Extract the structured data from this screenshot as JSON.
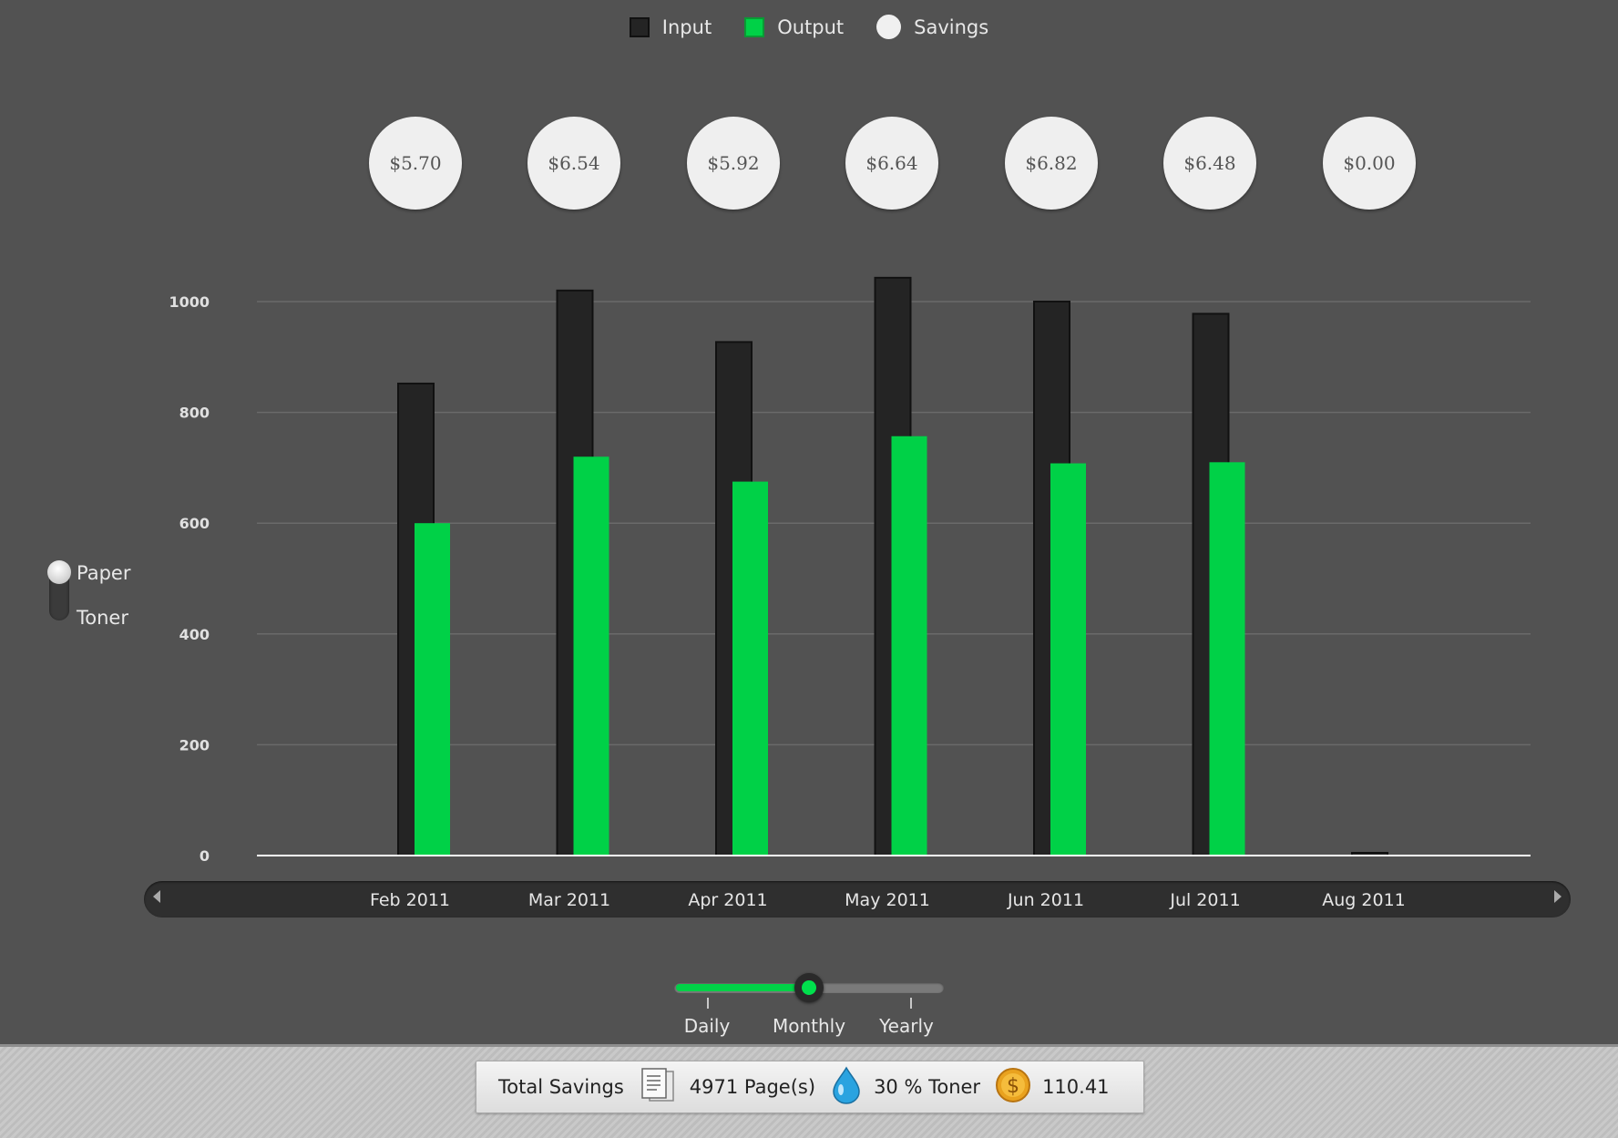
{
  "legend": {
    "input_label": "Input",
    "output_label": "Output",
    "savings_label": "Savings"
  },
  "colors": {
    "background": "#525252",
    "input_bar": "#242424",
    "output_bar": "#00d147",
    "gridline": "#6a6a6a",
    "bubble": "#efefef"
  },
  "savings": [
    "$5.70",
    "$6.54",
    "$5.92",
    "$6.64",
    "$6.82",
    "$6.48",
    "$0.00"
  ],
  "mode_toggle": {
    "paper_label": "Paper",
    "toner_label": "Toner",
    "selected": "Paper"
  },
  "period_slider": {
    "options": [
      "Daily",
      "Monthly",
      "Yearly"
    ],
    "selected": "Monthly"
  },
  "status_bar": {
    "label": "Total Savings",
    "pages": "4971 Page(s)",
    "toner": "30 % Toner",
    "money": "110.41"
  },
  "icons": {
    "scroll_left": "triangle-left-icon",
    "scroll_right": "triangle-right-icon",
    "pages": "document-pages-icon",
    "toner": "water-drop-icon",
    "money": "dollar-coin-icon"
  },
  "chart_data": {
    "type": "bar",
    "categories": [
      "Feb 2011",
      "Mar 2011",
      "Apr 2011",
      "May 2011",
      "Jun 2011",
      "Jul 2011",
      "Aug 2011"
    ],
    "series": [
      {
        "name": "Input",
        "values": [
          852,
          1020,
          927,
          1043,
          1000,
          978,
          2
        ]
      },
      {
        "name": "Output",
        "values": [
          600,
          720,
          675,
          757,
          708,
          710,
          0
        ]
      }
    ],
    "ylim": [
      0,
      1000
    ],
    "yticks": [
      "0",
      "200",
      "400",
      "600",
      "800",
      "1000"
    ],
    "grid": true,
    "legend_position": "top-center"
  }
}
